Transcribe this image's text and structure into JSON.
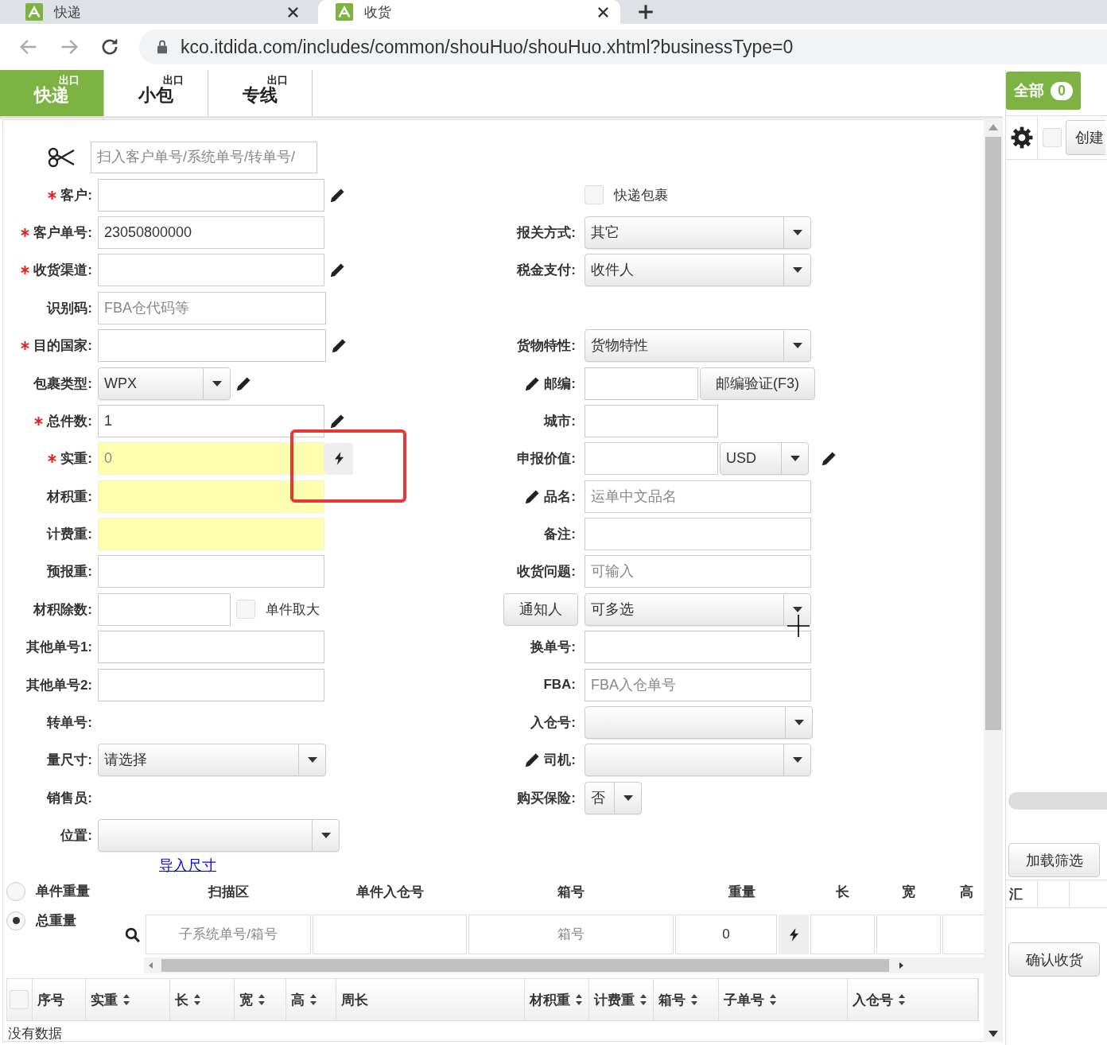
{
  "browser": {
    "tabs": [
      {
        "title": "快递",
        "selected": false
      },
      {
        "title": "收货",
        "selected": true
      }
    ],
    "url": "kco.itdida.com/includes/common/shouHuo/shouHuo.xhtml?businessType=0"
  },
  "module_tabs": [
    {
      "label": "快递",
      "badge": "出口",
      "selected": true
    },
    {
      "label": "小包",
      "badge": "出口",
      "selected": false
    },
    {
      "label": "专线",
      "badge": "出口",
      "selected": false
    }
  ],
  "form": {
    "scan": {
      "placeholder": "扫入客户单号/系统单号/转单号/"
    },
    "rows": [
      {
        "left": {
          "kind": "text",
          "label": "客户:",
          "required": true,
          "highlighted": false,
          "edit_icon_after": true
        },
        "right": {
          "kind": "checkbox",
          "label": "快递包裹",
          "checked": false,
          "required": false
        }
      },
      {
        "left": {
          "kind": "text",
          "label": "客户单号:",
          "required": true,
          "highlighted": false,
          "value": "23050800000"
        },
        "right": {
          "kind": "select",
          "label": "报关方式:",
          "required": false,
          "value": "其它"
        }
      },
      {
        "left": {
          "kind": "text",
          "label": "收货渠道:",
          "required": true,
          "highlighted": false,
          "edit_icon_after": true
        },
        "right": {
          "kind": "select",
          "label": "税金支付:",
          "required": false,
          "value": "收件人"
        }
      },
      {
        "left": {
          "kind": "text",
          "label": "识别码:",
          "required": false,
          "highlighted": false,
          "placeholder": "FBA仓代码等"
        }
      },
      {
        "left": {
          "kind": "text",
          "label": "目的国家:",
          "required": true,
          "highlighted": false,
          "edit_icon_after": true
        },
        "right": {
          "kind": "select",
          "label": "货物特性:",
          "required": false,
          "value": "货物特性"
        }
      },
      {
        "left": {
          "kind": "select",
          "label": "包裹类型:",
          "required": false,
          "value": "WPX",
          "edit_icon_after": true
        },
        "right": {
          "kind": "text_button",
          "label": "邮编:",
          "required": false,
          "highlighted": false,
          "edit_icon_before": true,
          "button": "邮编验证(F3)"
        }
      },
      {
        "left": {
          "kind": "text",
          "label": "总件数:",
          "required": true,
          "highlighted": false,
          "value": "1",
          "edit_icon_after": true
        },
        "right": {
          "kind": "text",
          "label": "城市:",
          "required": false,
          "highlighted": false
        }
      },
      {
        "left": {
          "kind": "text",
          "label": "实重:",
          "required": true,
          "highlighted": true,
          "placeholder": "0",
          "quick_fill": true
        },
        "right": {
          "kind": "text_select",
          "label": "申报价值:",
          "required": false,
          "highlighted": false,
          "select_value": "USD",
          "edit_icon_after": true
        }
      },
      {
        "left": {
          "kind": "text",
          "label": "材积重:",
          "required": false,
          "highlighted": true
        },
        "right": {
          "kind": "text",
          "label": "品名:",
          "required": false,
          "highlighted": false,
          "edit_icon_before": true,
          "placeholder": "运单中文品名"
        }
      },
      {
        "left": {
          "kind": "text",
          "label": "计费重:",
          "required": false,
          "highlighted": true
        },
        "right": {
          "kind": "text",
          "label": "备注:",
          "required": false,
          "highlighted": false
        }
      },
      {
        "left": {
          "kind": "text",
          "label": "预报重:",
          "required": false,
          "highlighted": false
        },
        "right": {
          "kind": "text",
          "label": "收货问题:",
          "required": false,
          "highlighted": false,
          "placeholder": "可输入"
        }
      },
      {
        "left": {
          "kind": "text_checkbox",
          "label": "材积除数:",
          "required": false,
          "highlighted": false,
          "option": {
            "label": "单件取大",
            "checked": false
          }
        },
        "right": {
          "kind": "button_select",
          "button": "通知人",
          "value": "可多选",
          "required": false
        }
      },
      {
        "left": {
          "kind": "text",
          "label": "其他单号1:",
          "required": false,
          "highlighted": false
        },
        "right": {
          "kind": "text",
          "label": "换单号:",
          "required": false,
          "highlighted": false
        }
      },
      {
        "left": {
          "kind": "text",
          "label": "其他单号2:",
          "required": false,
          "highlighted": false
        },
        "right": {
          "kind": "text",
          "label": "FBA:",
          "required": false,
          "highlighted": false,
          "placeholder": "FBA入仓单号"
        }
      },
      {
        "left": {
          "kind": "plain",
          "label": "转单号:",
          "required": false
        },
        "right": {
          "kind": "select",
          "label": "入仓号:",
          "required": false
        }
      },
      {
        "left": {
          "kind": "select",
          "label": "量尺寸:",
          "required": false,
          "value": "请选择"
        },
        "right": {
          "kind": "select",
          "label": "司机:",
          "required": false,
          "edit_icon_before": true
        }
      },
      {
        "left": {
          "kind": "plain",
          "label": "销售员:",
          "required": false
        },
        "right": {
          "kind": "select",
          "label": "购买保险:",
          "required": false,
          "value": "否"
        }
      },
      {
        "left": {
          "kind": "select",
          "label": "位置:",
          "required": false
        }
      }
    ]
  },
  "annotation": {
    "kind": "highlight_box"
  },
  "import_link": "导入尺寸",
  "weight_modes": [
    {
      "label": "单件重量",
      "selected": false
    },
    {
      "label": "总重量",
      "selected": true
    }
  ],
  "scan_zone": {
    "columns": [
      "扫描区",
      "单件入仓号",
      "箱号",
      "重量",
      "长",
      "宽",
      "高"
    ],
    "cells": [
      {
        "kind": "input",
        "placeholder": "子系统单号/箱号"
      },
      {
        "kind": "input"
      },
      {
        "kind": "input",
        "placeholder": "箱号"
      },
      {
        "kind": "input",
        "value": "0"
      },
      {
        "kind": "action"
      },
      {
        "kind": "input"
      },
      {
        "kind": "input"
      },
      {
        "kind": "input"
      }
    ]
  },
  "result_grid": {
    "select_all": {
      "checked": false
    },
    "columns": [
      {
        "label": "序号",
        "sortable": false
      },
      {
        "label": "实重",
        "sortable": true
      },
      {
        "label": "长",
        "sortable": true
      },
      {
        "label": "宽",
        "sortable": true
      },
      {
        "label": "高",
        "sortable": true
      },
      {
        "label": "周长",
        "sortable": false
      },
      {
        "label": "材积重",
        "sortable": true
      },
      {
        "label": "计费重",
        "sortable": true
      },
      {
        "label": "箱号",
        "sortable": true
      },
      {
        "label": "子单号",
        "sortable": true
      },
      {
        "label": "入仓号",
        "sortable": true
      }
    ],
    "empty_text": "没有数据"
  },
  "side_panel": {
    "all_tab": {
      "label": "全部",
      "count": "0",
      "selected": true
    },
    "select_all": {
      "checked": false
    },
    "create_button": "创建",
    "filter_button": "加载筛选",
    "summary_header": "汇",
    "confirm_button": "确认收货"
  }
}
